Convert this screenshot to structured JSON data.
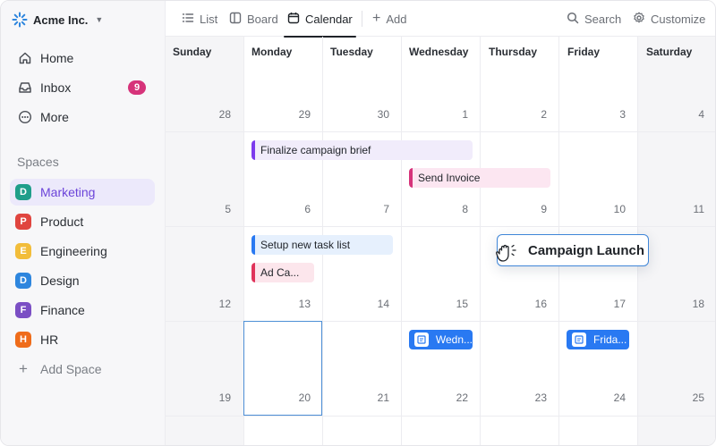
{
  "workspace": {
    "name": "Acme Inc."
  },
  "nav": [
    {
      "label": "Home",
      "icon": "home-icon"
    },
    {
      "label": "Inbox",
      "icon": "inbox-icon",
      "badge": "9"
    },
    {
      "label": "More",
      "icon": "more-icon"
    }
  ],
  "spaces": {
    "label": "Spaces",
    "items": [
      {
        "letter": "D",
        "label": "Marketing",
        "color": "#1f9e8a",
        "active": true
      },
      {
        "letter": "P",
        "label": "Product",
        "color": "#e0453f"
      },
      {
        "letter": "E",
        "label": "Engineering",
        "color": "#f2bd3a"
      },
      {
        "letter": "D",
        "label": "Design",
        "color": "#2e86de"
      },
      {
        "letter": "F",
        "label": "Finance",
        "color": "#7b4fc4"
      },
      {
        "letter": "H",
        "label": "HR",
        "color": "#ef6c1a"
      }
    ],
    "add_label": "Add Space"
  },
  "views": {
    "list": "List",
    "board": "Board",
    "calendar": "Calendar",
    "add": "Add",
    "search": "Search",
    "customize": "Customize"
  },
  "calendar": {
    "days": [
      "Sunday",
      "Monday",
      "Tuesday",
      "Wednesday",
      "Thursday",
      "Friday",
      "Saturday"
    ],
    "weeks": [
      [
        "28",
        "29",
        "30",
        "1",
        "2",
        "3",
        "4"
      ],
      [
        "5",
        "6",
        "7",
        "8",
        "9",
        "10",
        "11"
      ],
      [
        "12",
        "13",
        "14",
        "15",
        "16",
        "17",
        "18"
      ],
      [
        "19",
        "20",
        "21",
        "22",
        "23",
        "24",
        "25"
      ]
    ],
    "events": {
      "finalize": "Finalize campaign brief",
      "invoice": "Send Invoice",
      "setup": "Setup new task list",
      "adca": "Ad Ca...",
      "wedn": "Wedn...",
      "frida": "Frida..."
    },
    "dragging": "Campaign Launch"
  },
  "colors": {
    "accent_purple": "#7c3aed",
    "accent_pink": "#d6337a",
    "accent_blue": "#2979f2",
    "today_border": "#4d8fd6"
  }
}
